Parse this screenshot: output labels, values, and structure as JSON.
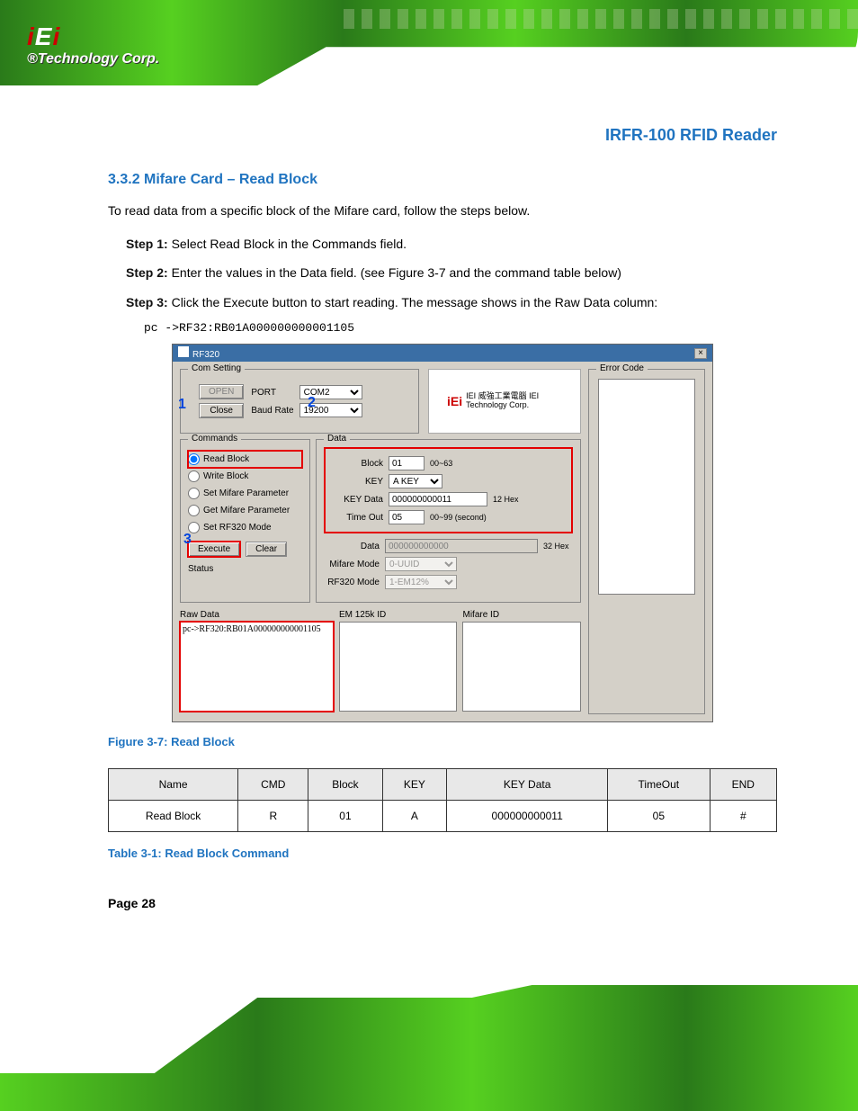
{
  "doc": {
    "header_title": "IRFR-100 RFID Reader",
    "section_num": "3.3.2 Mifare Card – Read Block",
    "intro": "To read data from a specific block of the Mifare card, follow the steps below.",
    "step1_pre": "Step 1:",
    "step1": "Select Read Block in the Commands field.",
    "step2_pre": "Step 2:",
    "step2": "Enter the values in the Data field. (see Figure 3-7 and the command table below)",
    "step3_pre": "Step 3:",
    "step3": "Click the Execute button to start reading. The message shows in the Raw Data column:",
    "note": "pc ->RF32:RB01A000000000001105",
    "fig_caption": "Figure 3-7: Read Block",
    "table": {
      "headers": [
        "Name",
        "CMD",
        "Block",
        "KEY",
        "KEY Data",
        "TimeOut",
        "END"
      ],
      "row": [
        "Read Block",
        "R",
        "01",
        "A",
        "000000000011",
        "05",
        "#"
      ]
    },
    "table_caption": "Table 3-1: Read Block Command",
    "page_num": "Page 28"
  },
  "ss": {
    "title": "RF320",
    "com": {
      "legend": "Com Setting",
      "open": "OPEN",
      "close": "Close",
      "port_lbl": "PORT",
      "port_val": "COM2",
      "baud_lbl": "Baud Rate",
      "baud_val": "19200"
    },
    "logo": "IEI 威強工業電腦  IEI Technology Corp.",
    "err_legend": "Error Code",
    "commands": {
      "legend": "Commands",
      "opts": [
        "Read Block",
        "Write Block",
        "Set Mifare Parameter",
        "Get Mifare Parameter",
        "Set RF320 Mode"
      ],
      "execute": "Execute",
      "clear": "Clear",
      "status": "Status"
    },
    "data": {
      "legend": "Data",
      "block_lbl": "Block",
      "block_val": "01",
      "block_hint": "00~63",
      "key_lbl": "KEY",
      "key_val": "A KEY",
      "keydata_lbl": "KEY Data",
      "keydata_val": "000000000011",
      "keydata_hint": "12 Hex",
      "timeout_lbl": "Time Out",
      "timeout_val": "05",
      "timeout_hint": "00~99 (second)",
      "data_lbl": "Data",
      "data_val": "000000000000",
      "data_hint": "32 Hex",
      "mifare_lbl": "Mifare Mode",
      "mifare_val": "0-UUID",
      "rf320_lbl": "RF320 Mode",
      "rf320_val": "1-EM12%"
    },
    "raw_lbl": "Raw Data",
    "raw_val": "pc->RF320:RB01A000000000001105",
    "em_lbl": "EM 125k ID",
    "mifare_id_lbl": "Mifare ID",
    "ann": {
      "n1": "1",
      "n2": "2",
      "n3": "3"
    }
  }
}
